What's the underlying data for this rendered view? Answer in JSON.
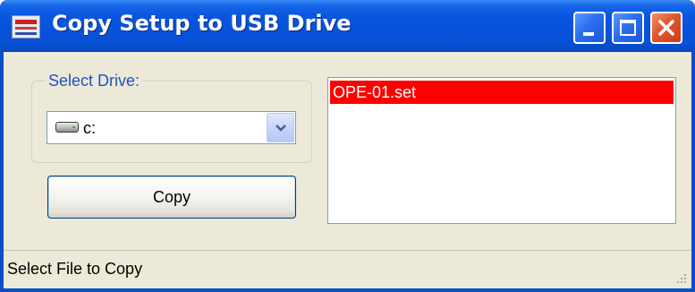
{
  "window": {
    "title": "Copy Setup to USB Drive",
    "app_icon": "app-logo-icon",
    "controls": {
      "minimize_icon": "minimize-icon",
      "maximize_icon": "maximize-icon",
      "close_icon": "close-icon"
    },
    "colors": {
      "titlebar": "#0752d8",
      "close_button": "#e0552c",
      "client_background": "#ece9d8"
    }
  },
  "drive_group": {
    "label": "Select Drive:",
    "selected_drive": "c:",
    "drive_icon": "hard-drive-icon",
    "dropdown_icon": "chevron-down-icon"
  },
  "copy_button": {
    "label": "Copy"
  },
  "file_list": {
    "items": [
      {
        "name": "OPE-01.set",
        "selected": true
      }
    ],
    "selection_color": "#ff0000"
  },
  "status_bar": {
    "text": "Select File to Copy",
    "grip_icon": "resize-grip-icon"
  }
}
